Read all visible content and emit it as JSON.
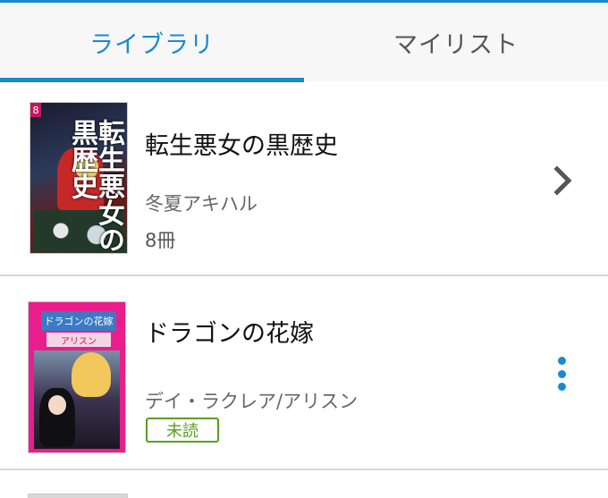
{
  "tabs": [
    {
      "label": "ライブラリ"
    },
    {
      "label": "マイリスト"
    }
  ],
  "books": [
    {
      "title": "転生悪女の黒歴史",
      "author": "冬夏アキハル",
      "volumes": "8冊",
      "action_icon": "chevron-right-icon",
      "cover_text": "転生悪女の黒歴史",
      "cover_badge": "8"
    },
    {
      "title": "ドラゴンの花嫁",
      "author": "デイ・ラクレア/アリスン",
      "status_badge": "未読",
      "action_icon": "more-vertical-icon",
      "cover_text": "ドラゴンの花嫁",
      "cover_sub": "アリスン"
    }
  ],
  "colors": {
    "accent": "#1a8ad0",
    "unread_badge": "#5a9e1f",
    "divider": "#d6d6d6"
  }
}
